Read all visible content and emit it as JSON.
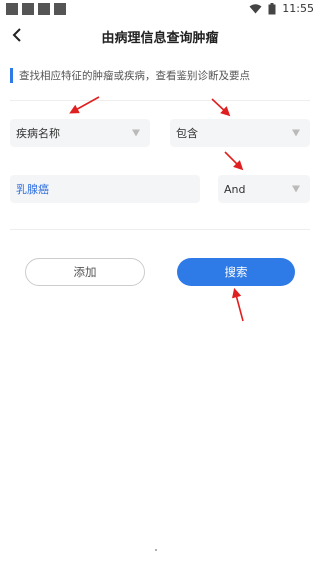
{
  "status_bar": {
    "time": "11:55",
    "icons": [
      "wifi-icon",
      "battery-icon"
    ]
  },
  "header": {
    "title": "由病理信息查询肿瘤",
    "back_icon": "chevron-left-icon"
  },
  "hint": {
    "text": "查找相应特征的肿瘤或疾病，查看鉴别诊断及要点",
    "accent": "#2e7ae6"
  },
  "form": {
    "field_select": "疾病名称",
    "operator_select": "包含",
    "value_input": "乳腺癌",
    "logic_select": "And"
  },
  "buttons": {
    "add_label": "添加",
    "search_label": "搜索"
  },
  "colors": {
    "primary": "#2e7ae6",
    "annotation_arrow": "#e02020"
  }
}
